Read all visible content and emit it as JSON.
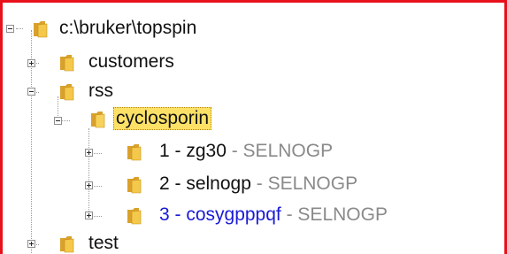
{
  "colors": {
    "frame_border": "#e8101a",
    "selection_bg": "#fde167",
    "highlight_text": "#1a1ad6",
    "secondary_text": "#8a8a8a"
  },
  "tree": {
    "root": {
      "label": "c:\\bruker\\topspin",
      "expanded": true,
      "icon": "folder-icon"
    },
    "customers": {
      "label": "customers",
      "expanded": false,
      "icon": "folder-icon"
    },
    "rss": {
      "label": "rss",
      "expanded": true,
      "icon": "folder-icon"
    },
    "cyclosporin": {
      "label": "cyclosporin",
      "expanded": true,
      "selected": true,
      "icon": "folder-open-icon"
    },
    "experiments": [
      {
        "name": "1 - zg30",
        "suffix": " - SELNOGP",
        "expanded": false,
        "highlighted": false
      },
      {
        "name": "2 - selnogp",
        "suffix": " - SELNOGP",
        "expanded": false,
        "highlighted": false
      },
      {
        "name": "3 - cosygpppqf",
        "suffix": " - SELNOGP",
        "expanded": false,
        "highlighted": true
      }
    ],
    "test": {
      "label": "test",
      "expanded": false,
      "icon": "folder-icon"
    }
  }
}
